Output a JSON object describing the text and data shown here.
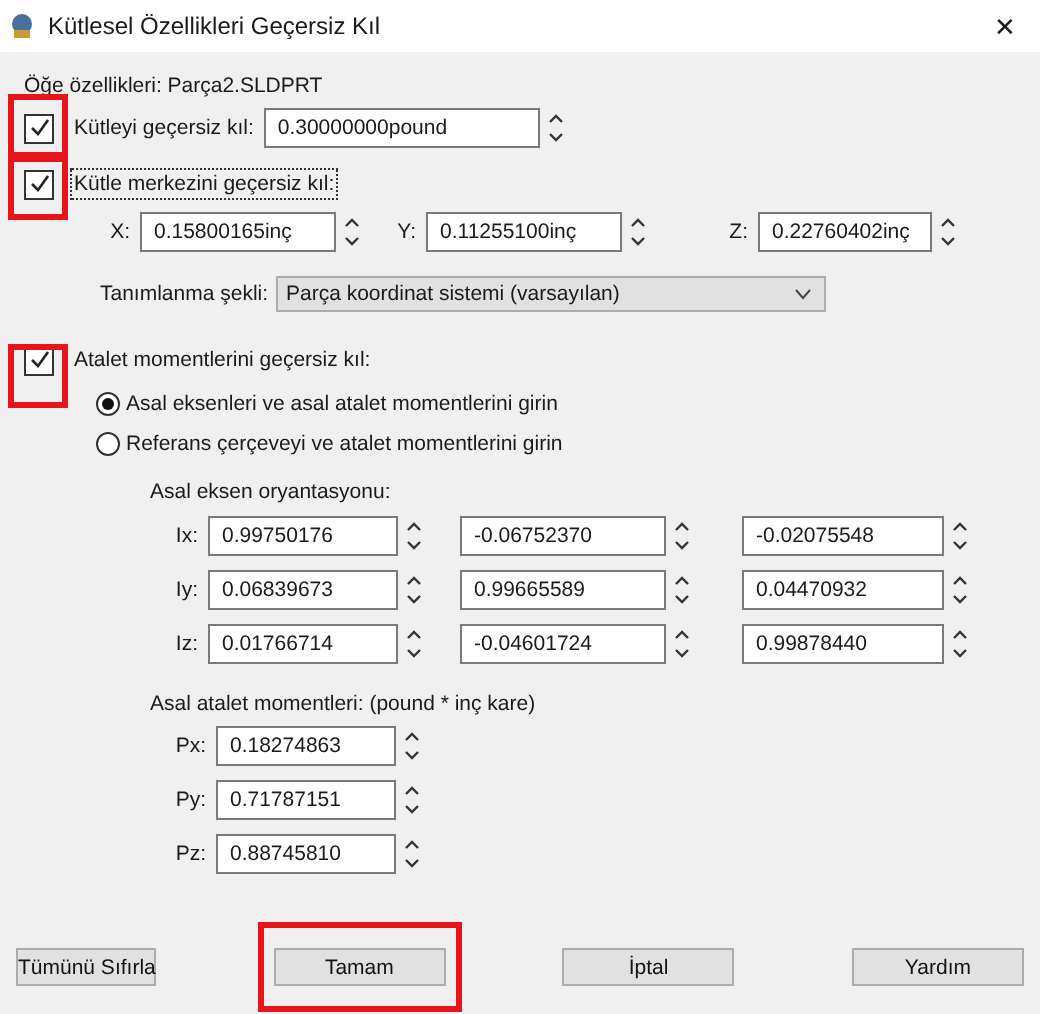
{
  "window": {
    "title": "Kütlesel Özellikleri Geçersiz Kıl",
    "close": "✕"
  },
  "item_properties": "Öğe özellikleri: Parça2.SLDPRT",
  "mass": {
    "label": "Kütleyi geçersiz kıl:",
    "checked": true,
    "highlighted": true,
    "value": "0.30000000pound"
  },
  "center": {
    "label": "Kütle merkezini geçersiz kıl:",
    "checked": true,
    "highlighted": true,
    "focused": true,
    "coords": [
      {
        "label": "X:",
        "value": "0.15800165inç"
      },
      {
        "label": "Y:",
        "value": "0.11255100inç"
      },
      {
        "label": "Z:",
        "value": "0.22760402inç"
      }
    ]
  },
  "defined_by": {
    "label": "Tanımlanma şekli:",
    "value": "Parça koordinat sistemi (varsayılan)"
  },
  "inertia": {
    "label": "Atalet momentlerini geçersiz kıl:",
    "checked": true,
    "highlighted": true,
    "options": [
      {
        "label": "Asal eksenleri ve asal atalet momentlerini girin",
        "selected": true
      },
      {
        "label": "Referans çerçeveyi ve atalet momentlerini girin",
        "selected": false
      }
    ],
    "axes_label": "Asal eksen oryantasyonu:",
    "axes": [
      {
        "label": "Ix:",
        "values": [
          "0.99750176",
          "-0.06752370",
          "-0.02075548"
        ]
      },
      {
        "label": "Iy:",
        "values": [
          "0.06839673",
          "0.99665589",
          "0.04470932"
        ]
      },
      {
        "label": "Iz:",
        "values": [
          "0.01766714",
          "-0.04601724",
          "0.99878440"
        ]
      }
    ],
    "moments_label": "Asal atalet momentleri: (pound * inç kare)",
    "moments": [
      {
        "label": "Px:",
        "value": "0.18274863"
      },
      {
        "label": "Py:",
        "value": "0.71787151"
      },
      {
        "label": "Pz:",
        "value": "0.88745810"
      }
    ]
  },
  "buttons": [
    {
      "label": "Tümünü Sıfırla",
      "highlighted": false
    },
    {
      "label": "Tamam",
      "highlighted": true
    },
    {
      "label": "İptal",
      "highlighted": false
    },
    {
      "label": "Yardım",
      "highlighted": false
    }
  ]
}
